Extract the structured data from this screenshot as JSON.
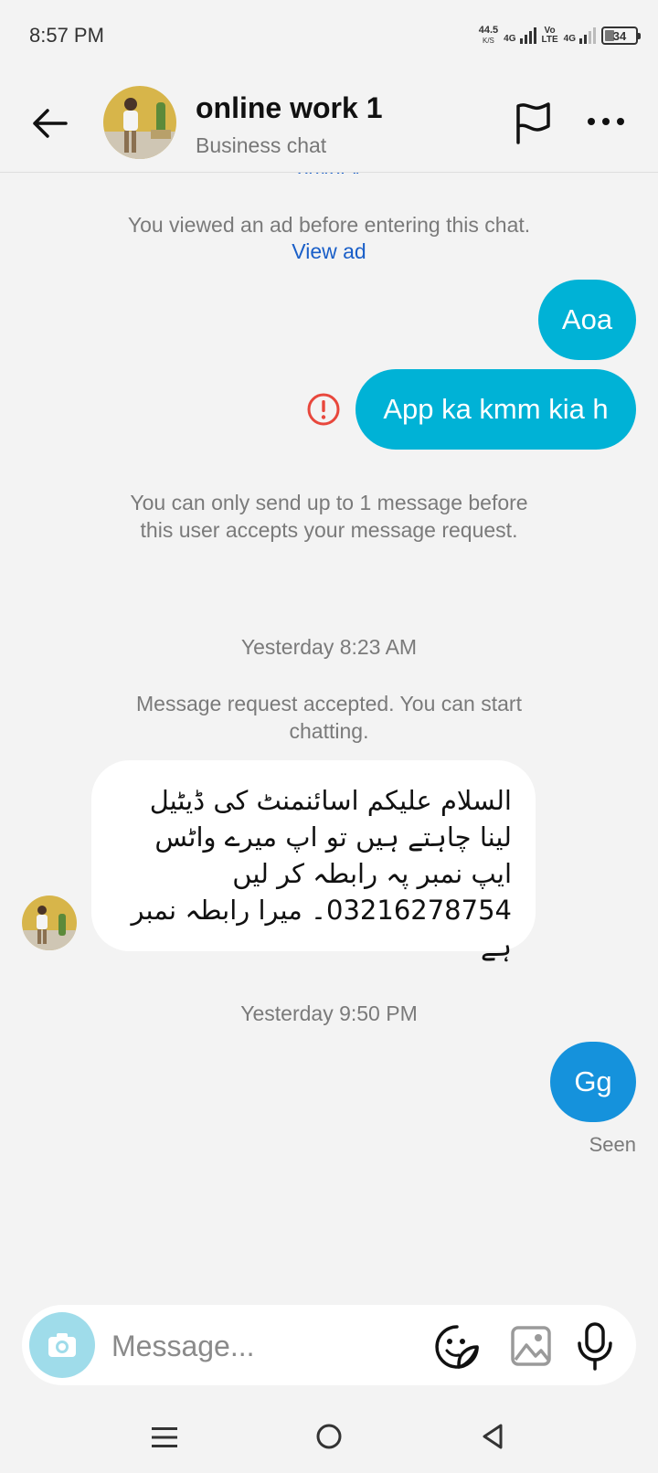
{
  "status_bar": {
    "time": "8:57 PM",
    "net_speed": "44.5",
    "net_unit": "K/S",
    "sim1_label": "4G",
    "volte_top": "Vo",
    "volte_bottom": "LTE",
    "sim2_label": "4G",
    "battery": "34"
  },
  "header": {
    "name": "online work 1",
    "subtitle": "Business chat"
  },
  "chat": {
    "privacy_text": "privacy",
    "ad_note": "You viewed an ad before entering this chat.",
    "view_ad": "View ad",
    "msg_out_1": "Aoa",
    "msg_out_2": "App ka kmm kia h",
    "limit_note": "You can only send up to 1 message before this user accepts your message request.",
    "time_1": "Yesterday 8:23 AM",
    "accepted_note": "Message request accepted. You can start chatting.",
    "msg_in_1": "السلام علیکم اسائنمنٹ کی ڈیٹیل لینا چاہتے ہیں تو اپ میرے واٹس ایپ نمبر پہ رابطہ کر لیں 03216278754۔ میرا رابطہ نمبر ہے",
    "time_2": "Yesterday 9:50 PM",
    "msg_out_3": "Gg",
    "seen": "Seen"
  },
  "composer": {
    "placeholder": "Message..."
  },
  "colors": {
    "bubble_out": "#00b2d6",
    "bubble_out_last": "#1592dc",
    "link": "#1a5fc8",
    "error": "#e8473c",
    "background": "#f3f3f3"
  }
}
